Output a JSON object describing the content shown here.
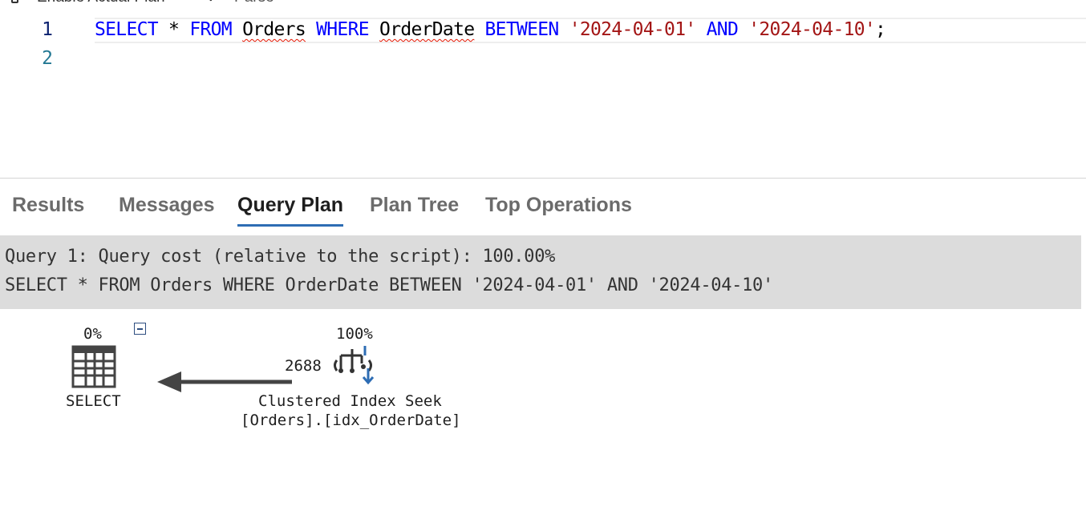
{
  "toolbar": {
    "enable_plan_label": "Enable Actual Plan",
    "check_glyph": "✓",
    "parse_label": "Parse"
  },
  "editor": {
    "line_numbers": [
      "1",
      "2"
    ],
    "line1": {
      "t1": "SELECT",
      "t2": " * ",
      "t3": "FROM",
      "t4": " ",
      "t5": "Orders",
      "t6": " ",
      "t7": "WHERE",
      "t8": " ",
      "t9": "OrderDate",
      "t10": " ",
      "t11": "BETWEEN",
      "t12": " ",
      "t13": "'2024-04-01'",
      "t14": " ",
      "t15": "AND",
      "t16": " ",
      "t17": "'2024-04-10'",
      "t18": ";"
    }
  },
  "tabs": [
    "Results",
    "Messages",
    "Query Plan",
    "Plan Tree",
    "Top Operations"
  ],
  "active_tab": "Query Plan",
  "query_header": {
    "line1": "Query 1: Query cost (relative to the script): 100.00%",
    "line2": "SELECT * FROM Orders WHERE OrderDate BETWEEN '2024-04-01' AND '2024-04-10'"
  },
  "plan": {
    "select_node": {
      "cost": "0%",
      "label": "SELECT"
    },
    "seek_node": {
      "cost": "100%",
      "label_line1": "Clustered Index Seek",
      "label_line2": "[Orders].[idx_OrderDate]"
    },
    "edge_row_count": "2688"
  },
  "colors": {
    "keyword": "#0000ff",
    "string": "#a31515",
    "active_tab_underline": "#2e6db4",
    "header_bg": "#dcdcdc"
  }
}
